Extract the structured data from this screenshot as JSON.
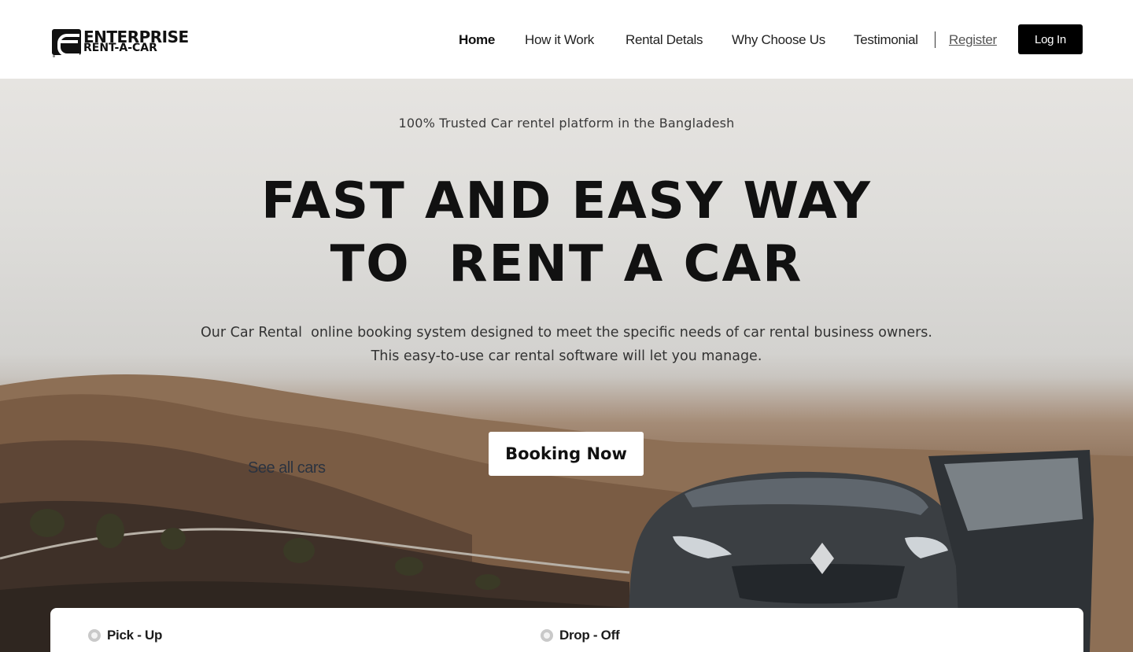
{
  "brand": {
    "line1": "ENTERPRISE",
    "line2": "RENT-A-CAR"
  },
  "nav": {
    "items": [
      {
        "label": "Home",
        "active": true
      },
      {
        "label": "How it Work",
        "active": false
      },
      {
        "label": "Rental Detals",
        "active": false
      },
      {
        "label": "Why Choose Us",
        "active": false
      },
      {
        "label": "Testimonial",
        "active": false
      }
    ],
    "register_label": "Register",
    "login_label": "Log In"
  },
  "hero": {
    "tagline": "100% Trusted Car rentel platform in the Bangladesh",
    "headline_line1": "FAST AND EASY WAY",
    "headline_line2": "TO  RENT A CAR",
    "subtext_line1": "Our Car Rental  online booking system designed to meet the specific needs of car rental business owners.",
    "subtext_line2": "This easy-to-use car rental software will let you manage.",
    "cta_label": "Booking Now",
    "secondary_link": "See all cars"
  },
  "booking_panel": {
    "options": [
      {
        "label": "Pick - Up",
        "selected": false
      },
      {
        "label": "Drop - Off",
        "selected": false
      }
    ]
  },
  "colors": {
    "primary_button": "#000000",
    "text_dark": "#111111",
    "hero_sky": "#e0dfdc",
    "hero_ground": "#8a6d55"
  }
}
